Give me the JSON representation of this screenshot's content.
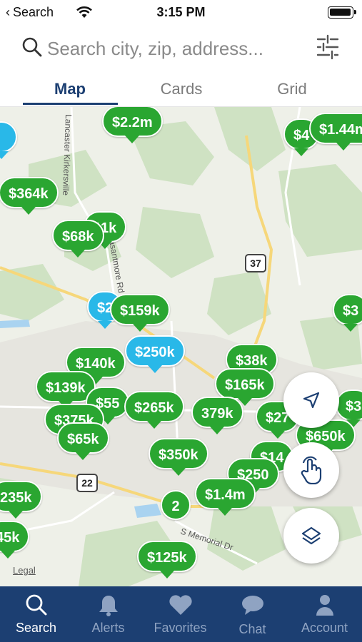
{
  "status_bar": {
    "back_label": "Search",
    "time": "3:15 PM"
  },
  "search": {
    "placeholder": "Search city, zip, address..."
  },
  "tabs": [
    {
      "label": "Map",
      "active": true
    },
    {
      "label": "Cards",
      "active": false
    },
    {
      "label": "Grid",
      "active": false
    }
  ],
  "map": {
    "road_labels": [
      "Lancaster Kirkersville",
      "Pleasantmore Rd",
      "S Memorial Dr"
    ],
    "route_shields": [
      "37",
      "22"
    ],
    "legal_label": "Legal",
    "pins": [
      {
        "label": "",
        "color": "#29b8e8"
      },
      {
        "label": "$2.2m",
        "color": "#2aa631"
      },
      {
        "label": "$4",
        "color": "#2aa631"
      },
      {
        "label": "$1.44m",
        "color": "#2aa631"
      },
      {
        "label": "$364k",
        "color": "#2aa631"
      },
      {
        "label": "11k",
        "color": "#2aa631"
      },
      {
        "label": "$68k",
        "color": "#2aa631"
      },
      {
        "label": "$2",
        "color": "#29b8e8"
      },
      {
        "label": "$159k",
        "color": "#2aa631"
      },
      {
        "label": "$3",
        "color": "#2aa631"
      },
      {
        "label": "$250k",
        "color": "#29b8e8"
      },
      {
        "label": "$140k",
        "color": "#2aa631"
      },
      {
        "label": "$38k",
        "color": "#2aa631"
      },
      {
        "label": "$139k",
        "color": "#2aa631"
      },
      {
        "label": "$165k",
        "color": "#2aa631"
      },
      {
        "label": "$55",
        "color": "#2aa631"
      },
      {
        "label": "$265k",
        "color": "#2aa631"
      },
      {
        "label": "379k",
        "color": "#2aa631"
      },
      {
        "label": "$27",
        "color": "#2aa631"
      },
      {
        "label": "$3",
        "color": "#2aa631"
      },
      {
        "label": "$375k",
        "color": "#2aa631"
      },
      {
        "label": "$65k",
        "color": "#2aa631"
      },
      {
        "label": "$650k",
        "color": "#2aa631"
      },
      {
        "label": "$350k",
        "color": "#2aa631"
      },
      {
        "label": "$14",
        "color": "#2aa631"
      },
      {
        "label": "$250",
        "color": "#2aa631"
      },
      {
        "label": "235k",
        "color": "#2aa631"
      },
      {
        "label": "$1.4m",
        "color": "#2aa631"
      },
      {
        "label": "2",
        "color": "#2aa631"
      },
      {
        "label": "45k",
        "color": "#2aa631"
      },
      {
        "label": "$125k",
        "color": "#2aa631"
      }
    ],
    "controls": [
      "location-arrow-icon",
      "hand-pointer-icon",
      "layers-icon"
    ]
  },
  "bottom_nav": [
    {
      "label": "Search",
      "icon": "search-icon",
      "active": true
    },
    {
      "label": "Alerts",
      "icon": "bell-icon",
      "active": false
    },
    {
      "label": "Favorites",
      "icon": "heart-icon",
      "active": false
    },
    {
      "label": "Chat",
      "icon": "chat-icon",
      "active": false
    },
    {
      "label": "Account",
      "icon": "person-icon",
      "active": false
    }
  ],
  "colors": {
    "accent": "#1c3f72",
    "pin_green": "#2aa631",
    "pin_blue": "#29b8e8"
  }
}
